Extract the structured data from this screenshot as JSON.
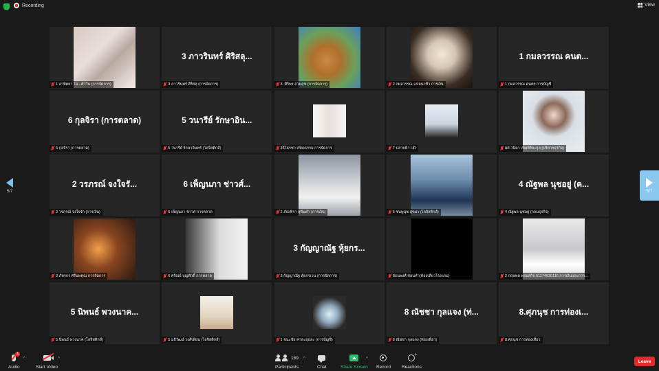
{
  "top_bar": {
    "recording_label": "Recording",
    "view_label": "View"
  },
  "navigation": {
    "page_indicator": "5/7"
  },
  "tiles": [
    {
      "label": "1 อาทิตยา โอ...ตัวใน (การจัดการ)",
      "display": "",
      "video": "v1",
      "muted": true
    },
    {
      "label": "3 ภาวรินทร์ ศิริสลุ (การจัดการ)",
      "display": "3 ภาวรินทร์ ศิริสลุ...",
      "video": "",
      "muted": true
    },
    {
      "label": "3. ศิริพร อ่วมสุข (การจัดการ)",
      "display": "",
      "video": "v2",
      "muted": true
    },
    {
      "label": "2 กมลวรรณ แปลนาชีว การเงิน",
      "display": "",
      "video": "v3",
      "muted": true
    },
    {
      "label": "1 กมลวรรณ คนตร การบัญชี",
      "display": "1 กมลวรรณ คนต...",
      "video": "",
      "muted": true
    },
    {
      "label": "6 กุลจิรา (การตลาด)",
      "display": "6 กุลจิรา (การตลาด)",
      "video": "",
      "muted": true
    },
    {
      "label": "5 วนารีย์ รักษาอินทร์ (โลจิสติกส์)",
      "display": "5 วนารีย์ รักษาอิน...",
      "video": "",
      "muted": true
    },
    {
      "label": "3ธิไธรชา เพียงธรรม การจัดการ",
      "display": "",
      "video": "v4",
      "small": true,
      "muted": true
    },
    {
      "label": "7 ปลายฟ้า HR",
      "display": "",
      "video": "v5",
      "small": true,
      "muted": true
    },
    {
      "label": "ผศ.วนิดา เพิ่มพิริยะกุล (บริหารธุรกิจ)",
      "display": "",
      "video": "v6",
      "muted": true
    },
    {
      "label": "2 วรภรณ์ จงใจรัก (การเงิน)",
      "display": "2 วรภรณ์ จงใจรั...",
      "video": "",
      "muted": true
    },
    {
      "label": "6 เพ็ญนภา ช่าวศ การตลาด",
      "display": "6 เพ็ญนภา ช่าวศ์...",
      "video": "",
      "muted": true
    },
    {
      "label": "2 ภัณฑิรา สุขันคำ (การเงิน)",
      "display": "",
      "video": "v7",
      "muted": true
    },
    {
      "label": "5 ชนพูนุช สุขมา (โลจิสติกส์)",
      "display": "",
      "video": "v8",
      "muted": true
    },
    {
      "label": "4 ณัฐพล นุชอยู่ (กลมธุรกิจ)",
      "display": "4 ณัฐพล นุชอยู่ (ค...",
      "video": "",
      "muted": true
    },
    {
      "label": "3 ภัทรกร ศรีนพคุณ การจัดการ",
      "display": "",
      "video": "v9",
      "muted": true
    },
    {
      "label": "6 ศรัณย์ บุญศักดิ์ การตลาด",
      "display": "",
      "video": "v10",
      "muted": true
    },
    {
      "label": "3 กัญญาณัฐ หุ้ยกรเวน (การจัดการ)",
      "display": "3 กัญญาณัฐ หุ้ยกร...",
      "video": "",
      "muted": true
    },
    {
      "label": "8ธนพงศ์ ชอนคำ(ท่องเที่ยวโรงแรม)",
      "display": "",
      "video": "v11",
      "muted": true
    },
    {
      "label": "2 กฤษพล พรมสกิจ 61174930116 การเงินและการ...",
      "display": "",
      "video": "v12",
      "muted": true
    },
    {
      "label": "5 นิพนธ์ พวงนาค (โลจิสติกส์)",
      "display": "5 นิพนธ์ พวงนาค...",
      "video": "",
      "muted": true
    },
    {
      "label": "5 มธิวัฒน์ วงศ์เพียน (โลจิสติกส์)",
      "display": "",
      "video": "v13",
      "small": true,
      "muted": true
    },
    {
      "label": "1 ชนะชัย คาละอุปละ (การบัญชี)",
      "display": "",
      "video": "v14",
      "small": true,
      "muted": true
    },
    {
      "label": "8 ณัชชา กุลแจง (ท่องเที่ยว)",
      "display": "8 ณัชชา กุลแจง (ท่...",
      "video": "",
      "muted": true
    },
    {
      "label": "8.ศุภนุช การท่องเที่ยว",
      "display": "8.ศุภนุช การท่องเ...",
      "video": "",
      "muted": true
    }
  ],
  "toolbar": {
    "audio_label": "Audio",
    "audio_badge": "1",
    "video_label": "Start Video",
    "participants_label": "Participants",
    "participants_count": "169",
    "chat_label": "Chat",
    "share_label": "Share Screen",
    "record_label": "Record",
    "reactions_label": "Reactions",
    "leave_label": "Leave",
    "caret": "^"
  },
  "colors": {
    "share_green": "#25c26c",
    "leave_red": "#e02b2b",
    "mute_red": "#e33333",
    "nav_blue": "#8bc8f0"
  }
}
